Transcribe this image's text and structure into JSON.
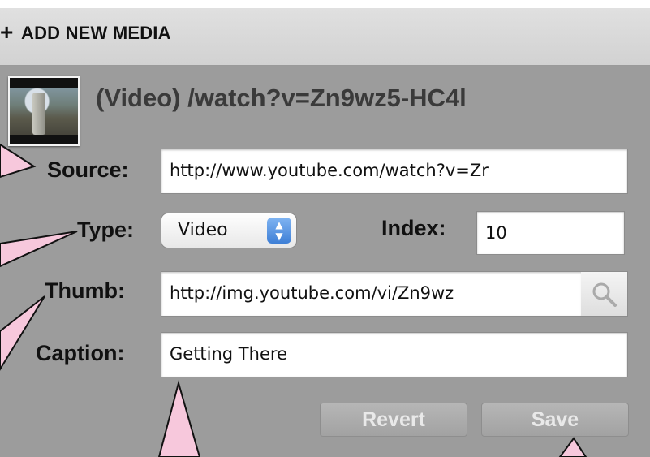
{
  "header": {
    "plus": "+",
    "title": "ADD NEW MEDIA"
  },
  "media": {
    "title": "(Video) /watch?v=Zn9wz5-HC4l",
    "thumbnail_icon": "video-thumbnail"
  },
  "form": {
    "source_label": "Source:",
    "source_value": "http://www.youtube.com/watch?v=Zr",
    "type_label": "Type:",
    "type_value": "Video",
    "index_label": "Index:",
    "index_value": "10",
    "thumb_label": "Thumb:",
    "thumb_value": "http://img.youtube.com/vi/Zn9wz",
    "caption_label": "Caption:",
    "caption_value": "Getting There",
    "search_icon": "magnifier-icon"
  },
  "buttons": {
    "revert": "Revert",
    "save": "Save"
  },
  "colors": {
    "panel_bg": "#9c9c9c",
    "header_bg": "#d8d8d8",
    "callout_fill": "#f7c8dc",
    "select_accent": "#3e7fd6",
    "button_disabled_text": "#e9e9e9"
  }
}
